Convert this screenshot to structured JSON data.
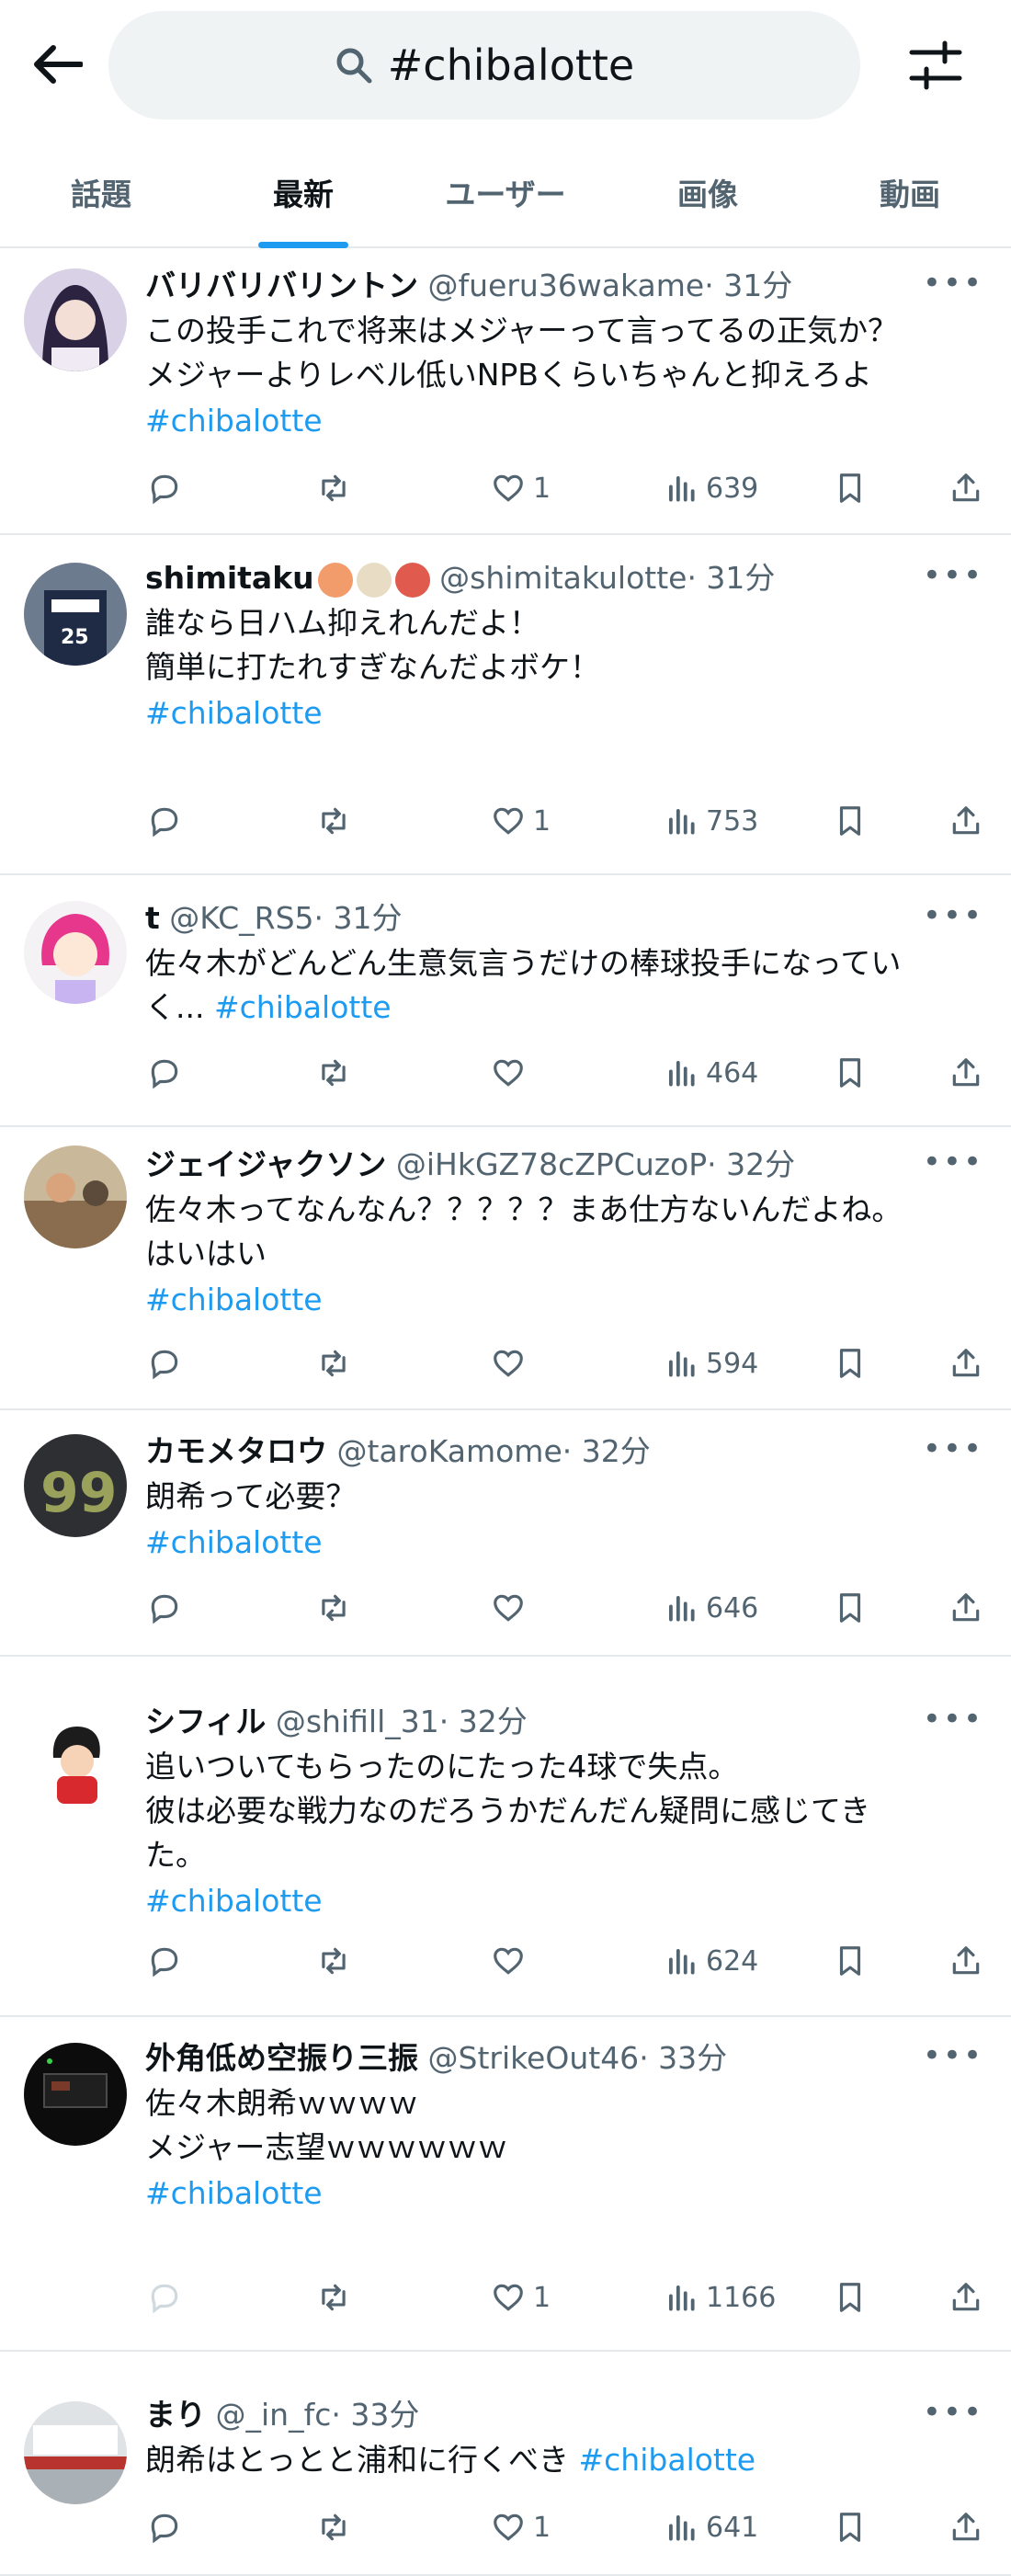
{
  "search": {
    "query": "#chibalotte"
  },
  "tabs": [
    {
      "label": "話題",
      "active": false
    },
    {
      "label": "最新",
      "active": true
    },
    {
      "label": "ユーザー",
      "active": false
    },
    {
      "label": "画像",
      "active": false
    },
    {
      "label": "動画",
      "active": false
    }
  ],
  "accent": "#1d9bf0",
  "tweets": [
    {
      "name": "バリバリバリントン",
      "handle": "@fueru36wakame",
      "time": "· 31分",
      "body": "この投手これで将来はメジャーって言ってるの正気か？\nメジャーよりレベル低いNPBくらいちゃんと抑えろよ",
      "hashtag": "#chibalotte",
      "likes": "1",
      "views": "639"
    },
    {
      "name": "shimitaku",
      "handle": "@shimitakulotte",
      "time": "· 31分",
      "body": "誰なら日ハム抑えれんだよ！\n簡単に打たれすぎなんだよボケ！\n",
      "hashtag": "#chibalotte",
      "likes": "1",
      "views": "753"
    },
    {
      "name": "t",
      "handle": "@KC_RS5",
      "time": "· 31分",
      "body": "佐々木がどんどん生意気言うだけの棒球投手になってい\nく...",
      "hashtag": "#chibalotte",
      "likes": "",
      "views": "464"
    },
    {
      "name": "ジェイジャクソン",
      "handle": "@iHkGZ78cZPCuzoP",
      "time": "· 32分",
      "body": "佐々木ってなんなん？？？？？まあ仕方ないんだよね。\nはいはい",
      "hashtag": "#chibalotte",
      "likes": "",
      "views": "594"
    },
    {
      "name": "カモメタロウ",
      "handle": "@taroKamome",
      "time": "· 32分",
      "body": "朗希って必要？",
      "hashtag": "#chibalotte",
      "likes": "",
      "views": "646"
    },
    {
      "name": "シフィル",
      "handle": "@shifill_31",
      "time": "· 32分",
      "body": "追いついてもらったのにたった4球で失点。\n彼は必要な戦力なのだろうかだんだん疑問に感じてき\nた。",
      "hashtag": "#chibalotte",
      "likes": "",
      "views": "624"
    },
    {
      "name": "外角低め空振り三振",
      "handle": "@StrikeOut46",
      "time": "· 33分",
      "body": "佐々木朗希ｗｗｗｗ\nメジャー志望ｗｗｗｗｗｗ\n",
      "hashtag": "#chibalotte",
      "likes": "1",
      "views": "1166"
    },
    {
      "name": "まり",
      "handle": "@_in_fc",
      "time": "· 33分",
      "body": "朗希はとっとと浦和に行くべき",
      "hashtag": "#chibalotte",
      "likes": "1",
      "views": "641"
    }
  ]
}
